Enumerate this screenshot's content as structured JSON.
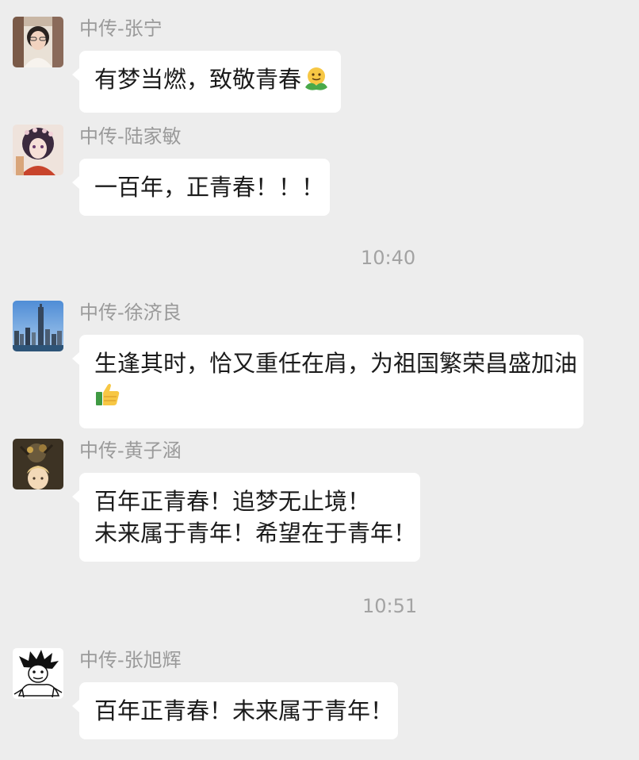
{
  "messages": [
    {
      "sender": "中传-张宁",
      "lines": [
        "有梦当燃，致敬青春"
      ],
      "emoji": "hug-emoji"
    },
    {
      "sender": "中传-陆家敏",
      "lines": [
        "一百年，正青春！！！"
      ]
    },
    {
      "sender": "中传-徐济良",
      "lines": [
        "生逢其时，恰又重任在肩，为祖国繁荣昌盛加油"
      ],
      "emoji": "thumbs-up-emoji"
    },
    {
      "sender": "中传-黄子涵",
      "lines": [
        "百年正青春！追梦无止境！",
        "未来属于青年！希望在于青年！"
      ]
    },
    {
      "sender": "中传-张旭辉",
      "lines": [
        "百年正青春！未来属于青年！"
      ]
    }
  ],
  "timestamps": [
    "10:40",
    "10:51"
  ],
  "colors": {
    "background": "#ededed",
    "bubble": "#ffffff",
    "sender_text": "#9a9a9a",
    "timestamp_text": "#a3a3a3",
    "message_text": "#1b1b1b"
  }
}
